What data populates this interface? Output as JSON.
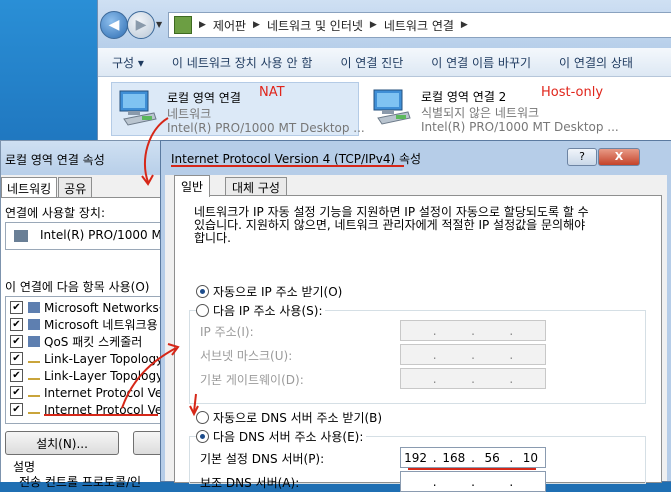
{
  "explorer": {
    "breadcrumbs": [
      "제어판",
      "네트워크 및 인터넷",
      "네트워크 연결"
    ],
    "toolbar": [
      "구성 ▾",
      "이 네트워크 장치 사용 안 함",
      "이 연결 진단",
      "이 연결 이름 바꾸기",
      "이 연결의 상태"
    ],
    "adapters": [
      {
        "name": "로컬 영역 연결",
        "status": "네트워크",
        "device": "Intel(R) PRO/1000 MT Desktop ...",
        "note": "NAT"
      },
      {
        "name": "로컬 영역 연결 2",
        "status": "식별되지 않은 네트워크",
        "device": "Intel(R) PRO/1000 MT Desktop ...",
        "note": "Host-only"
      }
    ]
  },
  "props_dialog": {
    "title": "로컬 영역 연결 속성",
    "tabs": [
      "네트워킹",
      "공유"
    ],
    "connect_using_label": "연결에 사용할 장치:",
    "device": "Intel(R) PRO/1000 MT",
    "items_label": "이 연결에 다음 항목 사용(O)",
    "items": [
      "Microsoft Networks용",
      "Microsoft 네트워크용",
      "QoS 패킷 스케줄러",
      "Link-Layer Topology",
      "Link-Layer Topology",
      "Internet Protocol Ver",
      "Internet Protocol Ver"
    ],
    "install_button": "설치(N)...",
    "description_label": "설명",
    "description_text": "전송 컨트롤 프로토콜/인"
  },
  "ipv4_dialog": {
    "title": "Internet Protocol Version 4 (TCP/IPv4) 속성",
    "help_button": "?",
    "close_button": "X",
    "tabs": [
      "일반",
      "대체 구성"
    ],
    "description": "네트워크가 IP 자동 설정 기능을 지원하면 IP 설정이 자동으로 할당되도록 할 수 있습니다. 지원하지 않으면, 네트워크 관리자에게 적절한 IP 설정값을 문의해야 합니다.",
    "auto_ip": "자동으로 IP 주소 받기(O)",
    "manual_ip": "다음 IP 주소 사용(S):",
    "ip_label": "IP 주소(I):",
    "subnet_label": "서브넷 마스크(U):",
    "gateway_label": "기본 게이트웨이(D):",
    "auto_dns": "자동으로 DNS 서버 주소 받기(B)",
    "manual_dns": "다음 DNS 서버 주소 사용(E):",
    "preferred_dns_label": "기본 설정 DNS 서버(P):",
    "preferred_dns": [
      "192",
      "168",
      "56",
      "10"
    ],
    "alternate_dns_label": "보조 DNS 서버(A):"
  },
  "colors": {
    "annotation": "#d62718",
    "title_bar": "#b6cde8"
  }
}
